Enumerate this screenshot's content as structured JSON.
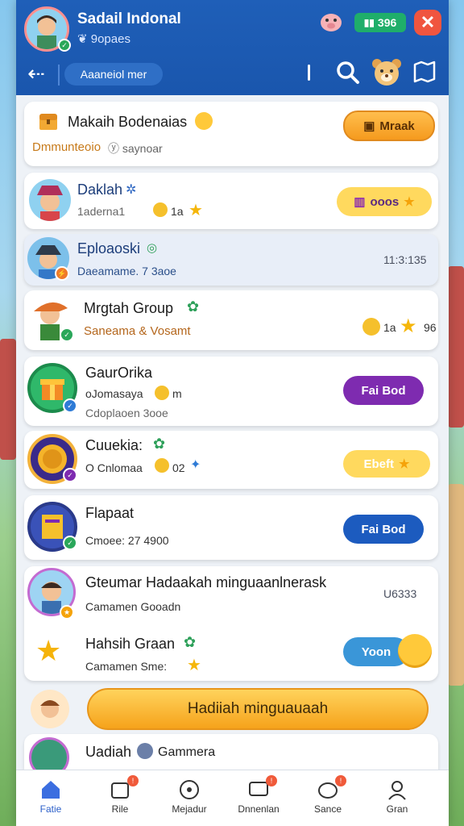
{
  "header": {
    "user_name": "Sadail Indonal",
    "user_sub": "❦ 9opaes",
    "coins": "396",
    "search_chip": "Aaaneiol mer"
  },
  "cards": [
    {
      "title": "Makaih Bodenaias",
      "sub_a": "Dmmunteoio",
      "sub_b": "ⓨ saynoar",
      "button": "Mraak"
    },
    {
      "title": "Daklah",
      "sub": "1aderna1",
      "count_a": "1a",
      "button": "ooos"
    },
    {
      "title": "Eploaoski",
      "sub": "Daeamame. 7 3aoe",
      "time": "11:3:135"
    },
    {
      "title": "Mrgtah Group",
      "sub": "Saneama & Vosamt",
      "count_a": "1a",
      "count_b": "96"
    },
    {
      "title": "GaurOrika",
      "sub_a": "oJomasaya",
      "sub_a2": "m",
      "sub_b": "Cdoplaoen 3ooe",
      "button": "Fai Bod"
    },
    {
      "title": "Cuuekia:",
      "sub": "O Cnlomaa",
      "count_a": "02",
      "button": "Ebeft"
    },
    {
      "title": "Flapaat",
      "sub": "Cmoee: 27 4900",
      "button": "Fai Bod"
    },
    {
      "title": "Gteumar Hadaakah minguaanlnerask",
      "sub": "Camamen Gooadn",
      "time": "U6333"
    },
    {
      "title": "Hahsih Graan",
      "sub": "Camamen Sme:",
      "button": "Yoon"
    },
    {
      "title": "Uadiah",
      "sub": "Gammera"
    }
  ],
  "cta_label": "Hadiiah minguauaah",
  "nav": [
    {
      "label": "Fatie",
      "icon": "home-icon"
    },
    {
      "label": "Rile",
      "icon": "ticket-icon"
    },
    {
      "label": "Mejadur",
      "icon": "compass-icon"
    },
    {
      "label": "Dnnenlan",
      "icon": "chat-icon"
    },
    {
      "label": "Sance",
      "icon": "piggy-icon"
    },
    {
      "label": "Gran",
      "icon": "profile-icon"
    }
  ],
  "colors": {
    "header": "#1d5ab0",
    "accent_orange": "#f6a31b",
    "purple": "#7e2bb0",
    "blue": "#1c5bbf"
  }
}
